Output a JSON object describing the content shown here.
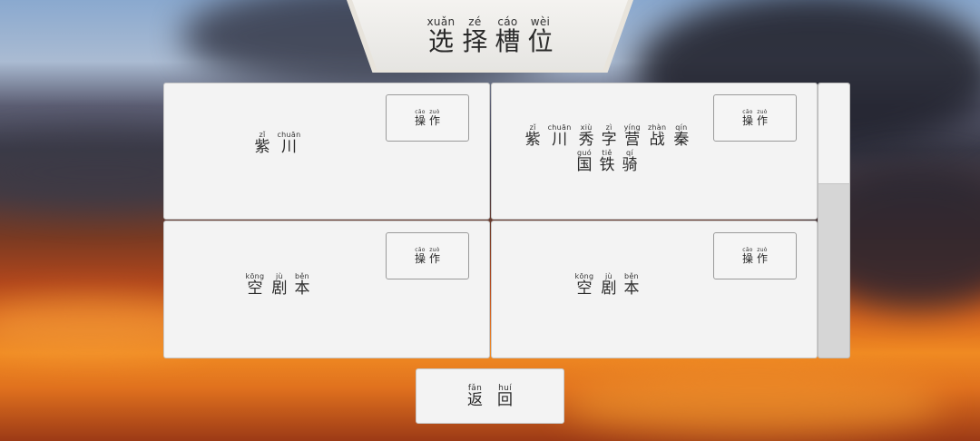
{
  "title": [
    {
      "py": "xuǎn",
      "hz": "选"
    },
    {
      "py": "zé",
      "hz": "择"
    },
    {
      "py": "cáo",
      "hz": "槽"
    },
    {
      "py": "wèi",
      "hz": "位"
    }
  ],
  "operate_button": [
    {
      "py": "cāo",
      "hz": "操"
    },
    {
      "py": "zuò",
      "hz": "作"
    }
  ],
  "slots": [
    {
      "lines": [
        [
          {
            "py": "zǐ",
            "hz": "紫"
          },
          {
            "py": "chuān",
            "hz": "川"
          }
        ]
      ]
    },
    {
      "lines": [
        [
          {
            "py": "zǐ",
            "hz": "紫"
          },
          {
            "py": "chuān",
            "hz": "川"
          },
          {
            "py": "xiù",
            "hz": "秀"
          },
          {
            "py": "zì",
            "hz": "字"
          },
          {
            "py": "yíng",
            "hz": "营"
          },
          {
            "py": "zhàn",
            "hz": "战"
          },
          {
            "py": "qín",
            "hz": "秦"
          }
        ],
        [
          {
            "py": "guó",
            "hz": "国"
          },
          {
            "py": "tiě",
            "hz": "铁"
          },
          {
            "py": "qí",
            "hz": "骑"
          }
        ]
      ]
    },
    {
      "lines": [
        [
          {
            "py": "kōng",
            "hz": "空"
          },
          {
            "py": "jù",
            "hz": "剧"
          },
          {
            "py": "běn",
            "hz": "本"
          }
        ]
      ]
    },
    {
      "lines": [
        [
          {
            "py": "kōng",
            "hz": "空"
          },
          {
            "py": "jù",
            "hz": "剧"
          },
          {
            "py": "běn",
            "hz": "本"
          }
        ]
      ]
    }
  ],
  "return_button": [
    {
      "py": "fǎn",
      "hz": "返"
    },
    {
      "py": "huí",
      "hz": "回"
    }
  ]
}
